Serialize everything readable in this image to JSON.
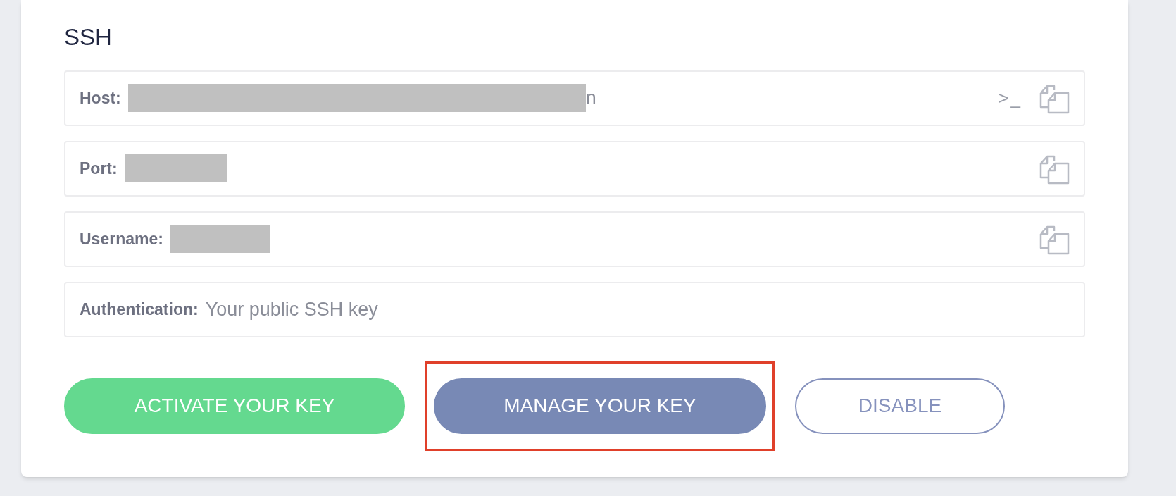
{
  "section": {
    "title": "SSH"
  },
  "fields": [
    {
      "label": "Host:",
      "redacted": true,
      "value": "n",
      "actions": [
        {
          "kind": "terminal",
          "text": ">_"
        },
        {
          "kind": "copy"
        }
      ]
    },
    {
      "label": "Port:",
      "redacted": true,
      "actions": [
        {
          "kind": "copy"
        }
      ]
    },
    {
      "label": "Username:",
      "redacted": true,
      "actions": [
        {
          "kind": "copy"
        }
      ]
    },
    {
      "label": "Authentication:",
      "redacted": false,
      "value": "Your public SSH key"
    }
  ],
  "buttons": [
    {
      "label": "ACTIVATE YOUR KEY",
      "kind": "success",
      "highlighted": false
    },
    {
      "label": "MANAGE YOUR KEY",
      "kind": "primary",
      "highlighted": true
    },
    {
      "label": "DISABLE",
      "kind": "outline",
      "highlighted": false
    }
  ]
}
